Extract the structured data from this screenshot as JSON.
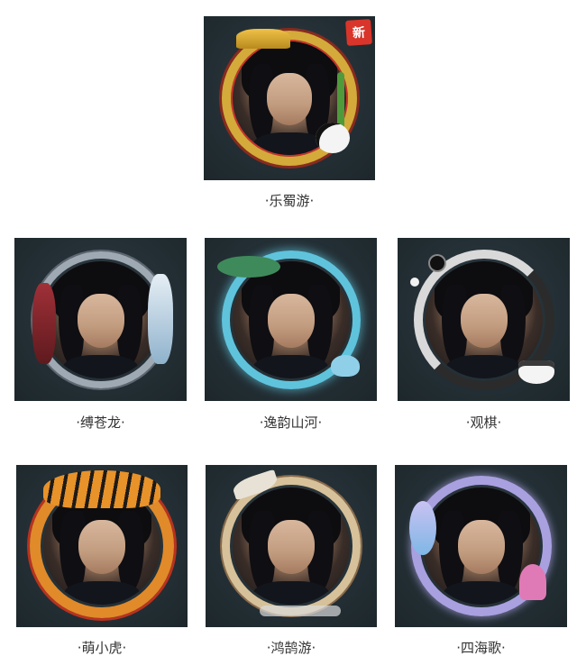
{
  "new_badge": "新",
  "frames": [
    {
      "id": "leshuyou",
      "caption": "·乐蜀游·",
      "ring_color": "#d4aa3a",
      "accent": "#c8322b",
      "has_new": true
    },
    {
      "id": "fucanglong",
      "caption": "·缚苍龙·",
      "ring_color": "#9ea9b3",
      "accent": "#8a2a2e",
      "has_new": false
    },
    {
      "id": "yiyunshanhe",
      "caption": "·逸韵山河·",
      "ring_color": "#5fc3dc",
      "accent": "#3f8a5a",
      "has_new": false
    },
    {
      "id": "guanqi",
      "caption": "·观棋·",
      "ring_color": "#d9d9d9",
      "accent": "#2b2b2b",
      "has_new": false
    },
    {
      "id": "mengxiaohu",
      "caption": "·萌小虎·",
      "ring_color": "#e08a2a",
      "accent": "#b8321f",
      "has_new": false
    },
    {
      "id": "honghuyou",
      "caption": "·鸿鹄游·",
      "ring_color": "#d6c19a",
      "accent": "#8a6a4a",
      "has_new": false
    },
    {
      "id": "sihaige",
      "caption": "·四海歌·",
      "ring_color": "#a9a0e0",
      "accent": "#e07ab6",
      "has_new": false
    }
  ]
}
